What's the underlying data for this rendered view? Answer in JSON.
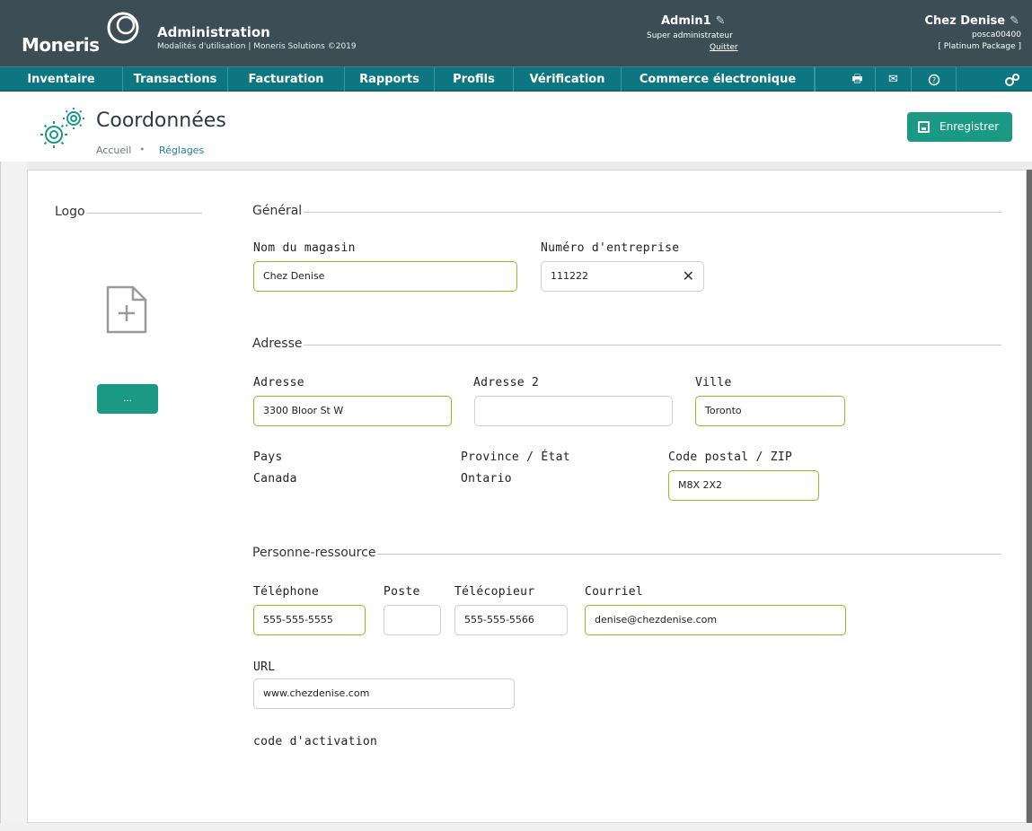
{
  "header": {
    "brand": "Moneris",
    "app_title": "Administration",
    "app_subtitle": "Modalités d'utilisation | Moneris Solutions ©2019",
    "admin_name": "Admin1",
    "admin_role": "Super administrateur",
    "quit_label": "Quitter",
    "store_name": "Chez Denise",
    "store_id": "posca00400",
    "store_package": "[ Platinum Package ]"
  },
  "nav": {
    "items": [
      "Inventaire",
      "Transactions",
      "Facturation",
      "Rapports",
      "Profils",
      "Vérification",
      "Commerce électronique"
    ],
    "icons": [
      "printer-icon",
      "mail-icon",
      "help-icon",
      "settings-icon"
    ]
  },
  "page": {
    "title": "Coordonnées",
    "breadcrumb_home": "Accueil",
    "breadcrumb_sep": "•",
    "breadcrumb_current": "Réglages",
    "save_label": "Enregistrer"
  },
  "logo_section": {
    "title": "Logo",
    "browse_label": "..."
  },
  "general": {
    "title": "Général",
    "store_name_label": "Nom du magasin",
    "store_name_value": "Chez Denise",
    "business_number_label": "Numéro d'entreprise",
    "business_number_value": "111222",
    "clear_symbol": "✕"
  },
  "address": {
    "title": "Adresse",
    "address_label": "Adresse",
    "address_value": "3300 Bloor St W",
    "address2_label": "Adresse 2",
    "address2_value": "",
    "city_label": "Ville",
    "city_value": "Toronto",
    "country_label": "Pays",
    "country_value": "Canada",
    "province_label": "Province / État",
    "province_value": "Ontario",
    "postal_label": "Code postal / ZIP",
    "postal_value": "M8X 2X2"
  },
  "contact": {
    "title": "Personne-ressource",
    "phone_label": "Téléphone",
    "phone_value": "555-555-5555",
    "ext_label": "Poste",
    "ext_value": "",
    "fax_label": "Télécopieur",
    "fax_value": "555-555-5566",
    "email_label": "Courriel",
    "email_value": "denise@chezdenise.com",
    "url_label": "URL",
    "url_value": "www.chezdenise.com",
    "activation_label": "code d'activation"
  },
  "colors": {
    "header_bg": "#3d4d55",
    "nav_bg": "#0d7680",
    "accent_button": "#1a9a84",
    "active_border": "#8bbf2a"
  }
}
